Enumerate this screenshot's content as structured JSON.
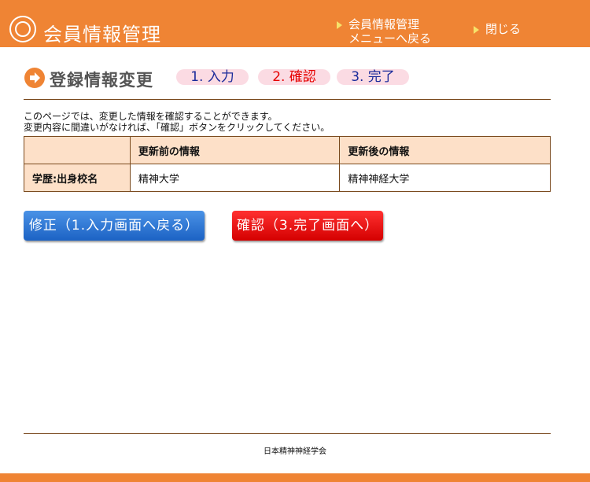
{
  "header": {
    "app_title": "会員情報管理",
    "nav_menu_line1": "会員情報管理",
    "nav_menu_line2": "メニューへ戻る",
    "nav_close": "閉じる",
    "logo_icon": "society-logo-icon",
    "accent": "#ef8434"
  },
  "page": {
    "title": "登録情報変更",
    "steps": [
      {
        "label": "1. 入力",
        "state": "inactive"
      },
      {
        "label": "2. 確認",
        "state": "active"
      },
      {
        "label": "3. 完了",
        "state": "inactive"
      }
    ],
    "description_line1": "このページでは、変更した情報を確認することができます。",
    "description_line2": "変更内容に間違いがなければ、「確認」ボタンをクリックしてください。"
  },
  "table": {
    "headers": [
      "",
      "更新前の情報",
      "更新後の情報"
    ],
    "rows": [
      {
        "label": "学歴:出身校名",
        "before": "精神大学",
        "after": "精神神経大学"
      }
    ]
  },
  "buttons": {
    "back": "修正（1.入力画面へ戻る）",
    "confirm": "確認（3.完了画面へ）"
  },
  "footer": {
    "organization": "日本精神神経学会"
  }
}
